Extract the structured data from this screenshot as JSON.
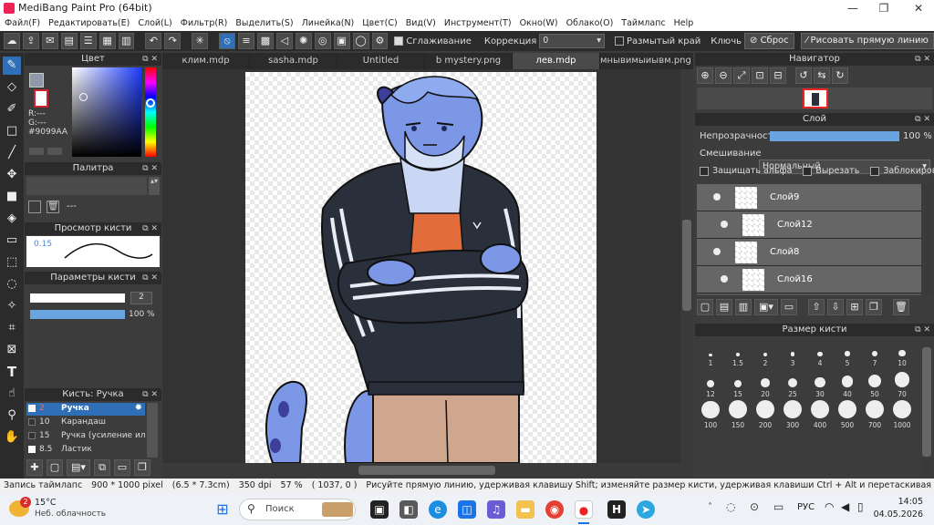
{
  "window": {
    "title": "MediBang Paint Pro (64bit)",
    "minimize": "—",
    "maximize": "❐",
    "close": "✕"
  },
  "menu": [
    "Файл(F)",
    "Редактировать(E)",
    "Слой(L)",
    "Фильтр(R)",
    "Выделить(S)",
    "Линейка(N)",
    "Цвет(C)",
    "Вид(V)",
    "Инструмент(T)",
    "Окно(W)",
    "Облако(O)",
    "Таймлапс",
    "Help"
  ],
  "toolbar": {
    "antialias_label": "Сглаживание",
    "correction_label": "Коррекция",
    "correction_value": "0",
    "blur_edge_label": "Размытый край",
    "key_label": "Ключь",
    "reset_label": "Сброс",
    "draw_line_label": "Рисовать прямую линию"
  },
  "color_panel": {
    "title": "Цвет",
    "r": "R:---",
    "g": "G:---",
    "hex": "#9099AA"
  },
  "palette_panel": {
    "title": "Палитра",
    "empty": "---"
  },
  "brush_preview": {
    "title": "Просмотр кисти",
    "size": "0.15"
  },
  "brush_params": {
    "title": "Параметры кисти",
    "size_value": "2",
    "opacity_value": "100 %"
  },
  "brush_list": {
    "title": "Кисть: Ручка",
    "items": [
      {
        "size": "2",
        "name": "Ручка"
      },
      {
        "size": "10",
        "name": "Карандаш"
      },
      {
        "size": "15",
        "name": "Ручка (усиление или"
      },
      {
        "size": "8.5",
        "name": "Ластик"
      }
    ]
  },
  "tabs": [
    "клим.mdp",
    "sasha.mdp",
    "Untitled",
    "b mystery.png",
    "лев.mdp",
    "мнывимыиывм.png"
  ],
  "navigator": {
    "title": "Навигатор"
  },
  "layer_panel": {
    "title": "Слой",
    "opacity_label": "Непрозрачность",
    "opacity_value": "100 %",
    "opacity_fraction": 1.0,
    "blend_label": "Смешивание",
    "blend_value": "Нормальный",
    "protect_alpha": "Защищать альфа",
    "clip": "Вырезать",
    "lock": "Заблокировать",
    "layers": [
      "Слой9",
      "Слой12",
      "Слой8",
      "Слой16"
    ]
  },
  "brush_size_panel": {
    "title": "Размер кисти",
    "sizes": [
      "1",
      "1.5",
      "2",
      "3",
      "4",
      "5",
      "7",
      "10",
      "12",
      "15",
      "20",
      "25",
      "30",
      "40",
      "50",
      "70",
      "100",
      "150",
      "200",
      "300",
      "400",
      "500",
      "700",
      "1000"
    ]
  },
  "status": {
    "timelapse": "Запись таймлапс",
    "size": "900 * 1000 pixel",
    "inches": "(6.5 * 7.3cm)",
    "dpi": "350 dpi",
    "zoom": "57 %",
    "coords": "( 1037, 0 )",
    "hint": "Рисуйте прямую линию, удерживая клавишу Shift; изменяйте размер кисти, удерживая клавиши Ctrl + Alt и перетаскивая"
  },
  "taskbar": {
    "weather_temp": "15°C",
    "weather_desc": "Неб. облачность",
    "weather_badge": "2",
    "search": "Поиск",
    "lang": "РУС",
    "time": "14:05",
    "date": "04.05.2026"
  },
  "colors": {
    "accent": "#2f6fb8",
    "fg_color": "#9099AA",
    "bg_color": "#cc4c6c"
  }
}
